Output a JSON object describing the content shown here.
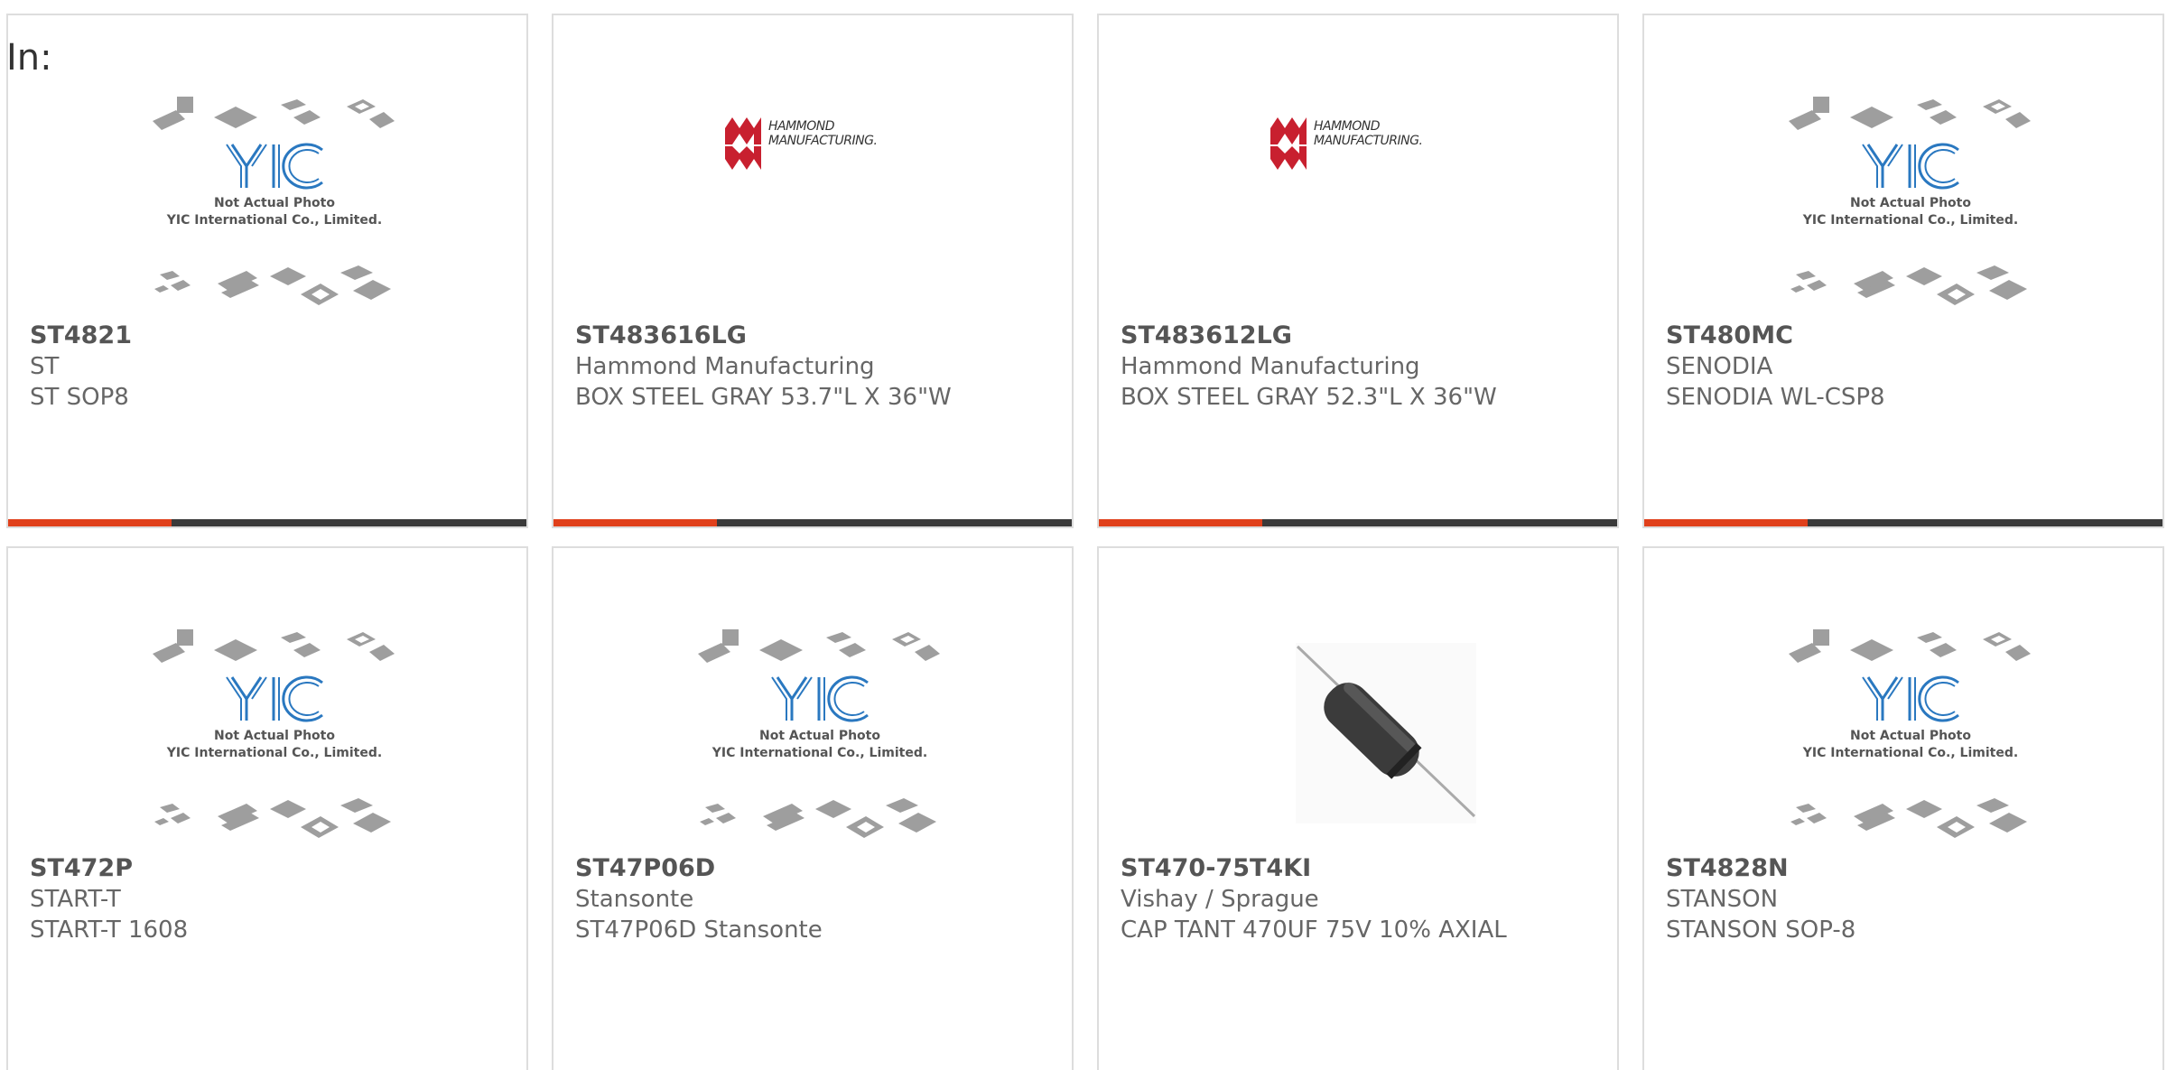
{
  "filter_label": "In:",
  "colors": {
    "accent": "#e0401b",
    "bar": "#3a3a3a",
    "border": "#dddddd",
    "yic_blue": "#2a78c0",
    "hammond_red": "#c8202f"
  },
  "placeholder_image": {
    "line1": "Not Actual Photo",
    "line2": "YIC International Co., Limited."
  },
  "hammond_logo": {
    "line1": "HAMMOND",
    "line2": "MANUFACTURING."
  },
  "products": [
    {
      "part_number": "ST4821",
      "manufacturer": "ST",
      "description": "ST SOP8",
      "image": "yic-placeholder"
    },
    {
      "part_number": "ST483616LG",
      "manufacturer": "Hammond Manufacturing",
      "description": "BOX STEEL GRAY 53.7\"L X 36\"W",
      "image": "hammond-logo"
    },
    {
      "part_number": "ST483612LG",
      "manufacturer": "Hammond Manufacturing",
      "description": "BOX STEEL GRAY 52.3\"L X 36\"W",
      "image": "hammond-logo"
    },
    {
      "part_number": "ST480MC",
      "manufacturer": "SENODIA",
      "description": "SENODIA WL-CSP8",
      "image": "yic-placeholder"
    },
    {
      "part_number": "ST472P",
      "manufacturer": "START-T",
      "description": "START-T 1608",
      "image": "yic-placeholder"
    },
    {
      "part_number": "ST47P06D",
      "manufacturer": "Stansonte",
      "description": "ST47P06D Stansonte",
      "image": "yic-placeholder"
    },
    {
      "part_number": "ST470-75T4KI",
      "manufacturer": "Vishay / Sprague",
      "description": "CAP TANT 470UF 75V 10% AXIAL",
      "image": "axial-capacitor"
    },
    {
      "part_number": "ST4828N",
      "manufacturer": "STANSON",
      "description": "STANSON SOP-8",
      "image": "yic-placeholder"
    }
  ]
}
